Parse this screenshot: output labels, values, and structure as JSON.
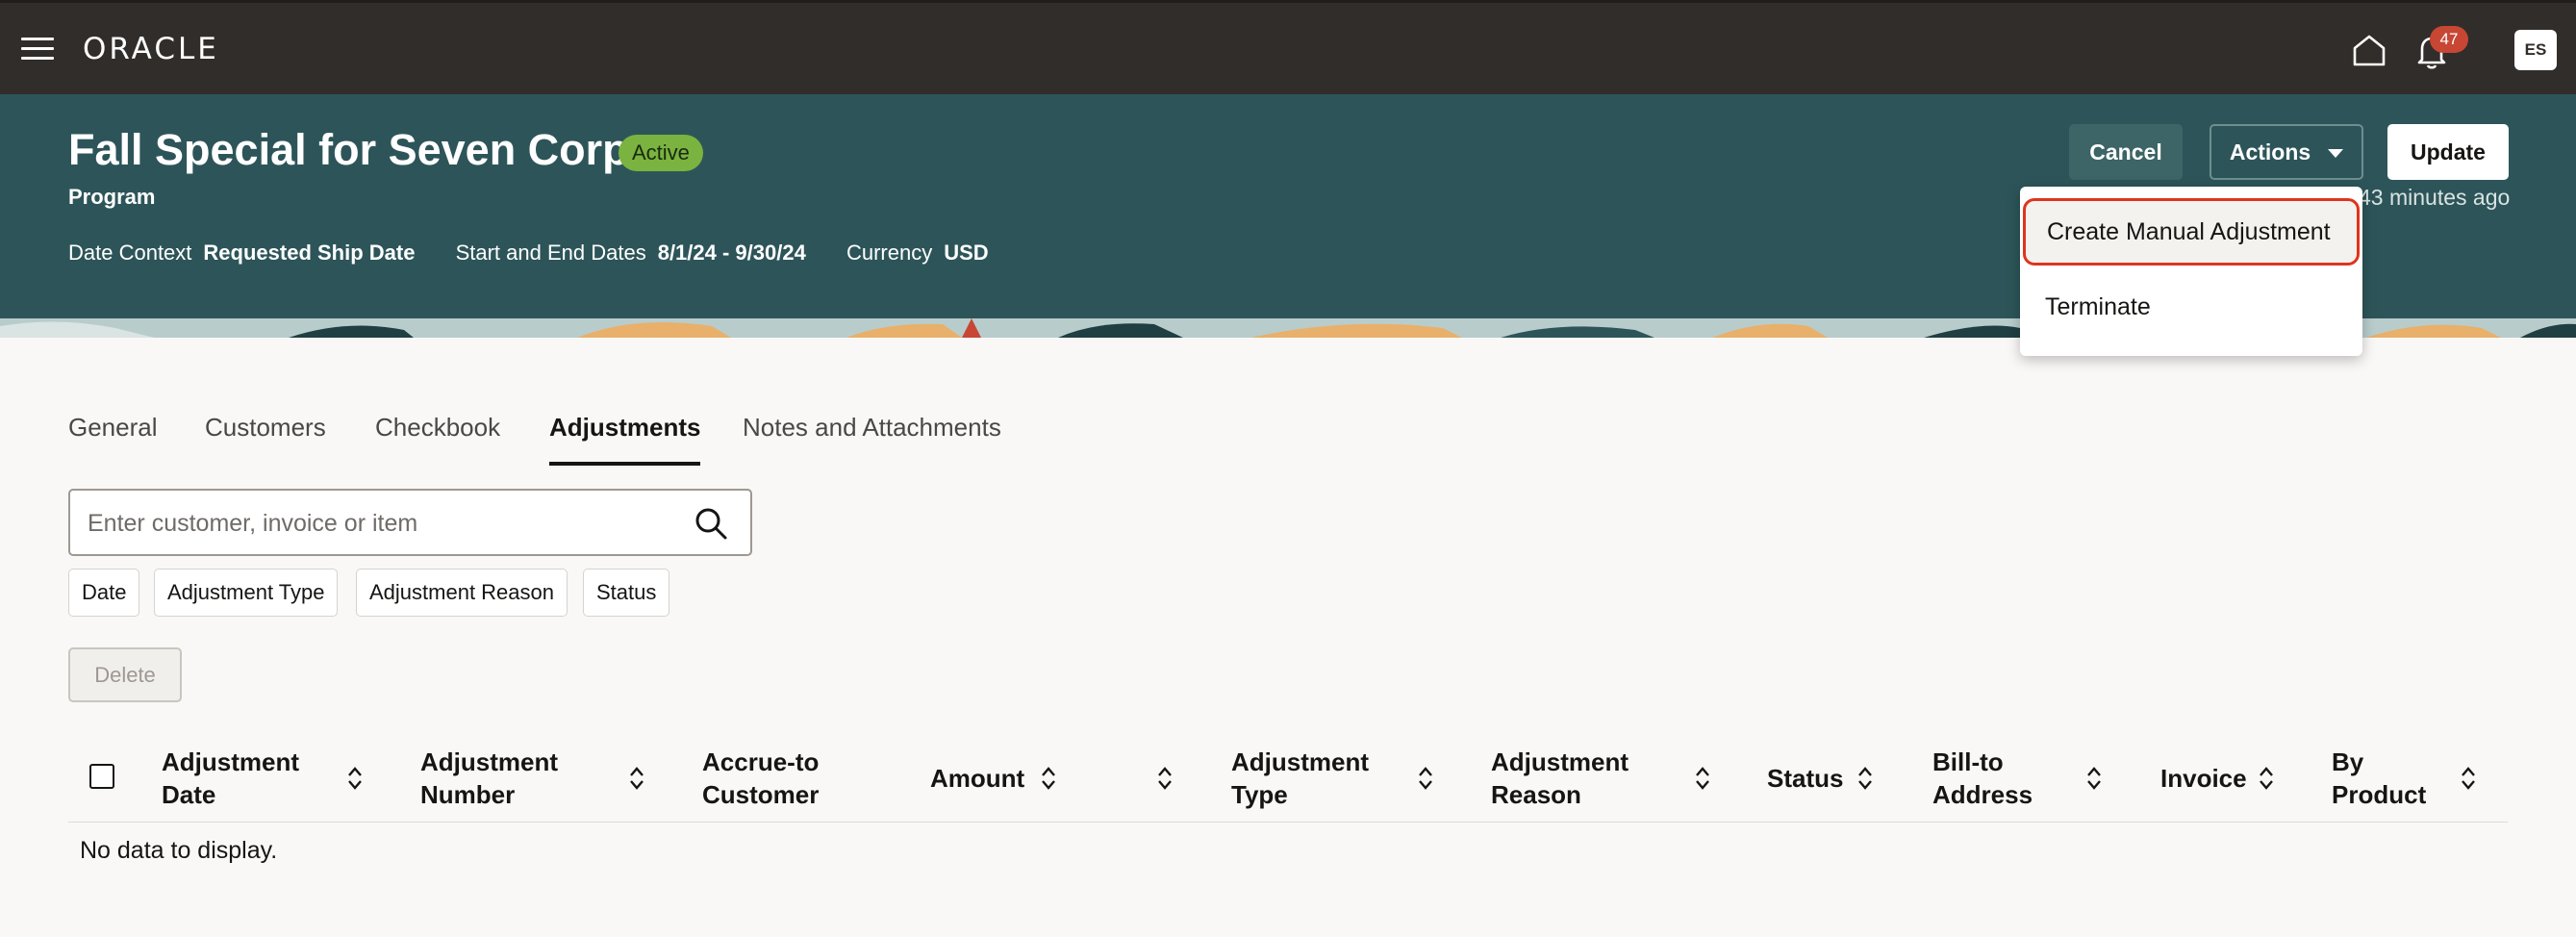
{
  "header": {
    "logo": "ORACLE",
    "notification_count": "47",
    "user_initials": "ES"
  },
  "banner": {
    "title": "Fall Special for Seven Corp",
    "status": "Active",
    "subtitle": "Program",
    "context": [
      {
        "label": "Date Context",
        "value": "Requested Ship Date"
      },
      {
        "label": "Start and End Dates",
        "value": "8/1/24 - 9/30/24"
      },
      {
        "label": "Currency",
        "value": "USD"
      }
    ],
    "buttons": {
      "cancel": "Cancel",
      "actions": "Actions",
      "update": "Update"
    },
    "updated_text": "43 minutes ago"
  },
  "actions_menu": {
    "items": [
      "Create Manual Adjustment",
      "Terminate"
    ]
  },
  "tabs": [
    "General",
    "Customers",
    "Checkbook",
    "Adjustments",
    "Notes and Attachments"
  ],
  "active_tab": "Adjustments",
  "search": {
    "placeholder": "Enter customer, invoice or item"
  },
  "filters": [
    "Date",
    "Adjustment Type",
    "Adjustment Reason",
    "Status"
  ],
  "delete_label": "Delete",
  "table": {
    "columns": [
      {
        "line1": "Adjustment",
        "line2": "Date"
      },
      {
        "line1": "Adjustment",
        "line2": "Number"
      },
      {
        "line1": "Accrue-to",
        "line2": "Customer"
      },
      {
        "line1": "Amount",
        "line2": ""
      },
      {
        "line1": "Adjustment",
        "line2": "Type"
      },
      {
        "line1": "Adjustment",
        "line2": "Reason"
      },
      {
        "line1": "Status",
        "line2": ""
      },
      {
        "line1": "Bill-to",
        "line2": "Address"
      },
      {
        "line1": "Invoice",
        "line2": ""
      },
      {
        "line1": "By",
        "line2": "Product"
      }
    ],
    "empty_message": "No data to display."
  },
  "colors": {
    "topbar": "#312d2a",
    "banner": "#2d5559",
    "status_green": "#7ab33f",
    "badge_red": "#c74634",
    "highlight_red": "#e0341d"
  }
}
